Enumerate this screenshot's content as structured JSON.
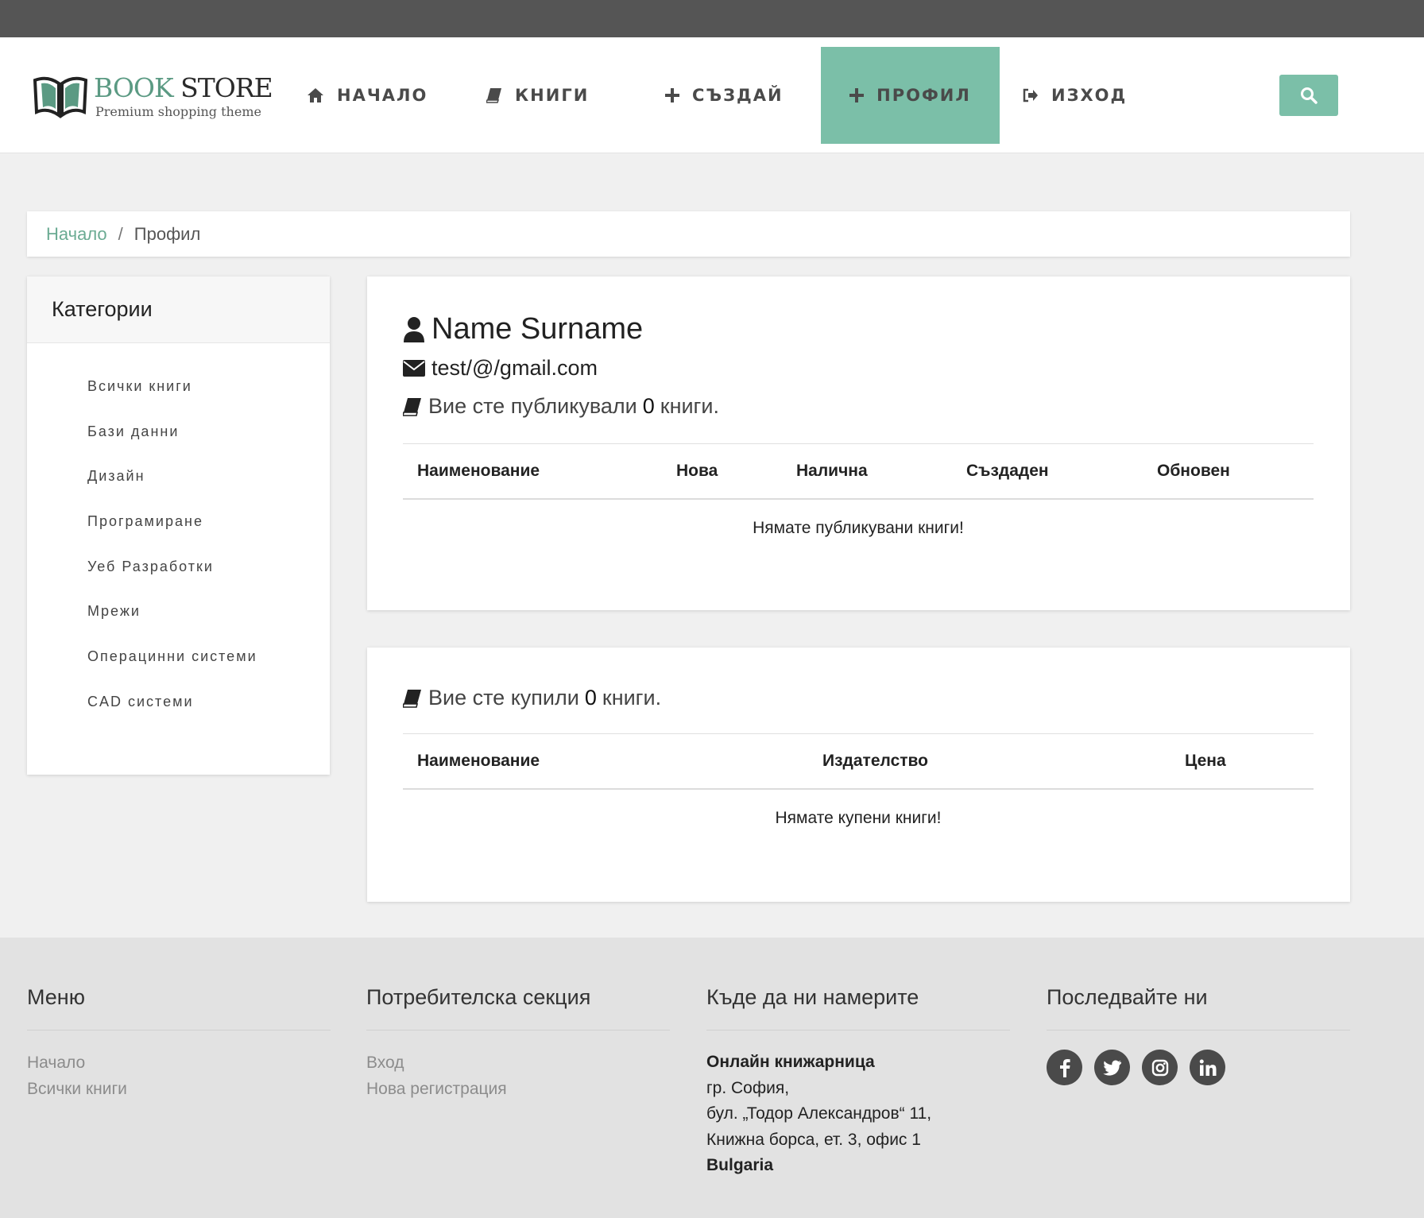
{
  "brand": {
    "title_part1": "BOOK",
    "title_part2": " STORE",
    "tagline": "Premium shopping theme"
  },
  "nav": {
    "items": [
      {
        "label": "НАЧАЛО",
        "icon": "home-icon"
      },
      {
        "label": "КНИГИ",
        "icon": "book-icon"
      },
      {
        "label": "СЪЗДАЙ",
        "icon": "plus-icon"
      },
      {
        "label": "ПРОФИЛ",
        "icon": "plus-icon",
        "active": true
      },
      {
        "label": "ИЗХОД",
        "icon": "sign-out-icon"
      }
    ],
    "search_icon": "search-icon"
  },
  "breadcrumb": {
    "home": "Начало",
    "separator": "/",
    "current": "Профил"
  },
  "sidebar": {
    "title": "Категории",
    "items": [
      "Всички книги",
      "Бази данни",
      "Дизайн",
      "Програмиране",
      "Уеб Разработки",
      "Мрежи",
      "Операцинни системи",
      "CAD системи"
    ]
  },
  "profile": {
    "name": "Name Surname",
    "email": "test/@/gmail.com",
    "published_prefix": "Вие сте публикували",
    "published_count": "0",
    "published_suffix": "книги.",
    "published_table": {
      "headers": [
        "Наименование",
        "Нова",
        "Налична",
        "Създаден",
        "Обновен"
      ],
      "empty": "Нямате публикувани книги!"
    },
    "bought_prefix": "Вие сте купили",
    "bought_count": "0",
    "bought_suffix": "книги.",
    "bought_table": {
      "headers": [
        "Наименование",
        "Издателство",
        "Цена"
      ],
      "empty": "Нямате купени книги!"
    }
  },
  "footer": {
    "menu": {
      "title": "Меню",
      "links": [
        "Начало",
        "Всички книги"
      ]
    },
    "user": {
      "title": "Потребителска секция",
      "links": [
        "Вход",
        "Нова регистрация"
      ]
    },
    "location": {
      "title": "Къде да ни намерите",
      "name": "Онлайн книжарница",
      "lines": [
        "гр. София,",
        "бул. „Тодор Александров“ 11,",
        "Книжна борса, ет. 3, офис 1"
      ],
      "country": "Bulgaria"
    },
    "social": {
      "title": "Последвайте ни",
      "icons": [
        "facebook-icon",
        "twitter-icon",
        "instagram-icon",
        "linkedin-icon"
      ]
    }
  },
  "colors": {
    "accent": "#7bbfa8",
    "topbar": "#555555",
    "footer_bg": "#e2e2e2"
  }
}
